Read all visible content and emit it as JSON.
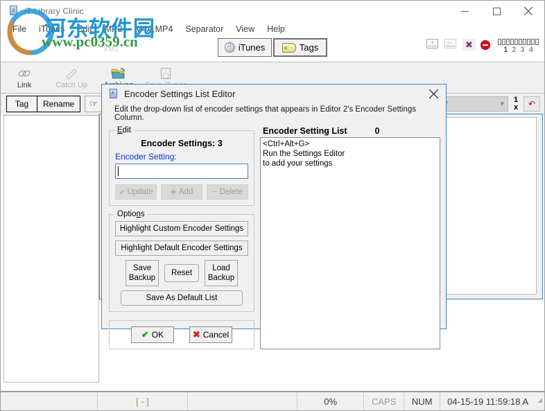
{
  "window": {
    "title": "iT Library Clinic",
    "controls": {
      "minimize": "minimize-button",
      "maximize": "maximize-button",
      "close": "close-button"
    }
  },
  "menu": {
    "items": [
      {
        "label": "File"
      },
      {
        "label": "iTunes"
      },
      {
        "label": "Edit"
      },
      {
        "label": "MP3"
      },
      {
        "label": "M4A,MP4"
      },
      {
        "label": "Separator"
      },
      {
        "label": "View"
      },
      {
        "label": "Help"
      }
    ]
  },
  "modebar": {
    "xml_label": "XML",
    "itunes_button": "iTunes",
    "tags_button": "Tags",
    "page_numbers": [
      "1",
      "2",
      "3",
      "4"
    ],
    "active_page": "1",
    "tick_count": 10
  },
  "toolbar": {
    "buttons": [
      {
        "label": "Link",
        "icon": "link-icon",
        "enabled": true
      },
      {
        "label": "Catch Up",
        "icon": "catch-up-icon",
        "enabled": false
      },
      {
        "label": "Archives",
        "icon": "archives-folder-icon",
        "enabled": true
      },
      {
        "label": "Save iTunes",
        "icon": "floppy-disk-icon",
        "enabled": false
      }
    ]
  },
  "subtoolbar": {
    "tag_button": "Tag",
    "rename_button": "Rename",
    "pointer_icon": "pointing-hand-icon",
    "combo_value": "* *",
    "counter_top": "1",
    "counter_bottom": "x",
    "undo_icon": "red-undo-arrow-icon"
  },
  "statusbar": {
    "selection": "[  -  ]",
    "progress": "0%",
    "caps": "CAPS",
    "num": "NUM",
    "datetime": "04-15-19 11:59:18 A"
  },
  "dialog": {
    "title": "Encoder Settings List Editor",
    "icon": "settings-document-icon",
    "close_label": "✕",
    "description": "Edit the drop-down list of encoder settings that appears in Editor 2's Encoder Settings Column.",
    "edit_group": {
      "legend": "Edit",
      "heading": "Encoder Settings: 3",
      "field_label": "Encoder Setting:",
      "field_value": "",
      "field_placeholder": "",
      "buttons": [
        {
          "label": "Update",
          "icon": "check-icon",
          "enabled": false
        },
        {
          "label": "Add",
          "icon": "plus-icon",
          "enabled": false
        },
        {
          "label": "Delete",
          "icon": "minus-icon",
          "enabled": false
        }
      ]
    },
    "options_group": {
      "legend": "Options",
      "highlight_custom": "Highlight Custom Encoder Settings",
      "highlight_default": "Highlight Default Encoder Settings",
      "save_backup": "Save\nBackup",
      "save_backup_line1": "Save",
      "save_backup_line2": "Backup",
      "reset": "Reset",
      "load_backup_line1": "Load",
      "load_backup_line2": "Backup",
      "save_as_default": "Save As Default List"
    },
    "footer": {
      "ok": "OK",
      "cancel": "Cancel"
    },
    "list_panel": {
      "title": "Encoder Setting List",
      "count": "0",
      "lines": [
        "<Ctrl+Alt+G>",
        "Run the Settings Editor",
        "to add your settings"
      ]
    }
  },
  "watermark": {
    "chinese": "河东软件园",
    "url": "www.pc0359.cn"
  },
  "colors": {
    "accent_blue": "#3f82c4",
    "label_blue": "#0a2fd4",
    "watermark_blue": "#2196d6",
    "watermark_green": "#2e9b43",
    "watermark_orange": "#e8862a",
    "stop_red": "#d0021b"
  }
}
